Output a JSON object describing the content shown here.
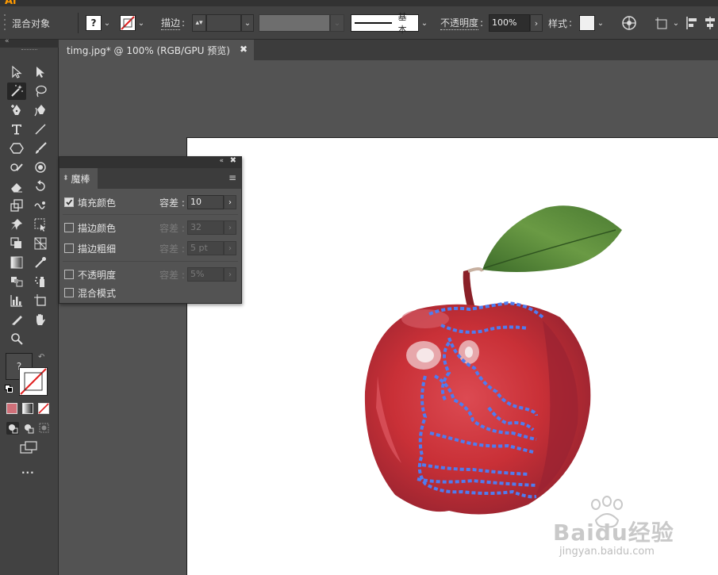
{
  "app": {
    "logo": "Ai"
  },
  "control_bar": {
    "mode_label": "混合对象",
    "fill_swatch_symbol": "?",
    "stroke_label": "描边",
    "brush_label": "基本",
    "opacity_label": "不透明度",
    "opacity_value": "100%",
    "style_label": "样式"
  },
  "document_tab": {
    "title": "timg.jpg* @ 100% (RGB/GPU 预览)"
  },
  "toolbar": {
    "swatch_symbol": "?",
    "more_label": "..."
  },
  "wand_panel": {
    "title": "魔棒",
    "rows": [
      {
        "label": "填充颜色",
        "checked": true,
        "tolerance_label": "容差",
        "tolerance_value": "10"
      },
      {
        "label": "描边颜色",
        "checked": false,
        "tolerance_label": "容差",
        "tolerance_value": "32"
      },
      {
        "label": "描边粗细",
        "checked": false,
        "tolerance_label": "容差",
        "tolerance_value": "5 pt"
      },
      {
        "label": "不透明度",
        "checked": false,
        "tolerance_label": "容差",
        "tolerance_value": "5%"
      },
      {
        "label": "混合模式",
        "checked": false
      }
    ]
  },
  "watermark": {
    "brand": "Baidu经验",
    "url": "jingyan.baidu.com"
  },
  "colors": {
    "selection": "#4f7cf0",
    "apple_red": "#c93037",
    "leaf_green": "#5a8a3a"
  }
}
